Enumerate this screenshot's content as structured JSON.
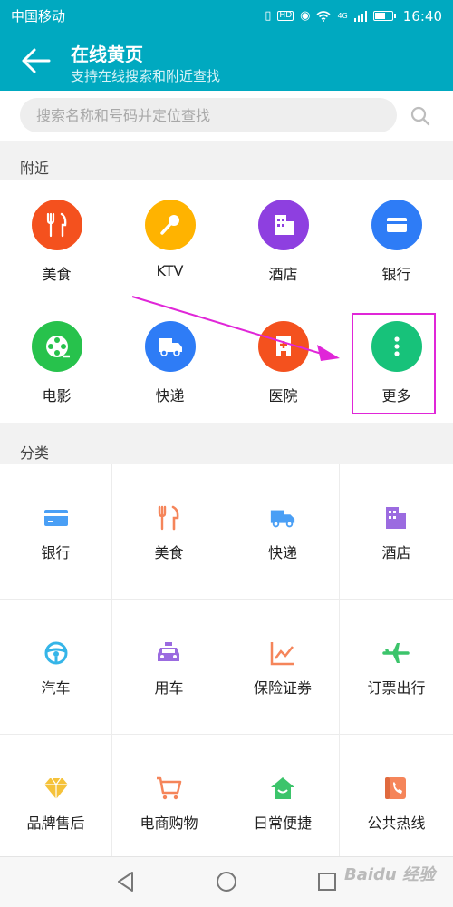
{
  "status_bar": {
    "carrier": "中国移动",
    "hd_badge": "HD",
    "network": "4G",
    "time": "16:40"
  },
  "header": {
    "title": "在线黄页",
    "subtitle": "支持在线搜索和附近查找"
  },
  "search": {
    "placeholder": "搜索名称和号码并定位查找",
    "value": ""
  },
  "nearby": {
    "label": "附近",
    "items": [
      {
        "label": "美食",
        "icon": "food-icon",
        "color": "#f4511e"
      },
      {
        "label": "KTV",
        "icon": "microphone-icon",
        "color": "#ffb300"
      },
      {
        "label": "酒店",
        "icon": "hotel-icon",
        "color": "#8e3fe0"
      },
      {
        "label": "银行",
        "icon": "bank-card-icon",
        "color": "#2e7cf6"
      },
      {
        "label": "电影",
        "icon": "film-reel-icon",
        "color": "#27c24c"
      },
      {
        "label": "快递",
        "icon": "delivery-truck-icon",
        "color": "#2e7cf6"
      },
      {
        "label": "医院",
        "icon": "hospital-icon",
        "color": "#f4511e"
      },
      {
        "label": "更多",
        "icon": "more-dots-icon",
        "color": "#17c27a"
      }
    ]
  },
  "category": {
    "label": "分类",
    "items": [
      {
        "label": "银行",
        "icon": "bank-card-icon",
        "color": "#4a9ff5"
      },
      {
        "label": "美食",
        "icon": "food-icon",
        "color": "#f5855a"
      },
      {
        "label": "快递",
        "icon": "delivery-truck-icon",
        "color": "#4a9ff5"
      },
      {
        "label": "酒店",
        "icon": "hotel-icon",
        "color": "#9b6be0"
      },
      {
        "label": "汽车",
        "icon": "steering-wheel-icon",
        "color": "#35b5e8"
      },
      {
        "label": "用车",
        "icon": "taxi-icon",
        "color": "#9b6be0"
      },
      {
        "label": "保险证券",
        "icon": "stock-chart-icon",
        "color": "#f5855a"
      },
      {
        "label": "订票出行",
        "icon": "airplane-icon",
        "color": "#3cc46b"
      },
      {
        "label": "品牌售后",
        "icon": "diamond-icon",
        "color": "#f5c23a"
      },
      {
        "label": "电商购物",
        "icon": "shopping-cart-icon",
        "color": "#f5855a"
      },
      {
        "label": "日常便捷",
        "icon": "home-smile-icon",
        "color": "#3cc46b"
      },
      {
        "label": "公共热线",
        "icon": "phone-book-icon",
        "color": "#f5855a"
      }
    ]
  },
  "annotation": {
    "box_color": "#e026d8",
    "arrow_color": "#e026d8"
  },
  "watermark": "Baidu 经验"
}
